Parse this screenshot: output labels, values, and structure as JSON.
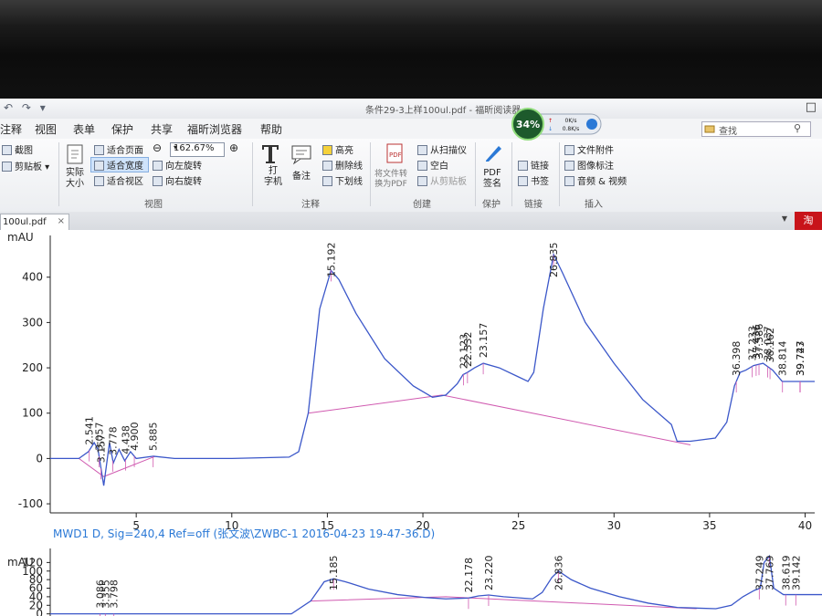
{
  "app": {
    "title": "条件29-3上样100ul.pdf - 福昕阅读器",
    "quick_access": "↶ ↷ ▾"
  },
  "menu": [
    "注释",
    "视图",
    "表单",
    "保护",
    "共享",
    "福昕浏览器",
    "帮助"
  ],
  "search": {
    "placeholder": "查找"
  },
  "ribbon": {
    "screenshot": "截图",
    "clipboard": "剪贴板",
    "actual_size": [
      "实际",
      "大小"
    ],
    "fit_page": "适合页面",
    "fit_width": "适合宽度",
    "fit_view": "适合视区",
    "zoom": "162.67%",
    "rotate_left": "向左旋转",
    "rotate_right": "向右旋转",
    "group_view": "视图",
    "typewriter": [
      "打",
      "字机"
    ],
    "note": "备注",
    "highlight": "高亮",
    "strikeout": "删除线",
    "underline": "下划线",
    "group_comment": "注释",
    "convert": [
      "将文件转",
      "换为PDF"
    ],
    "from_scanner": "从扫描仪",
    "blank": "空白",
    "from_clipboard": "从剪贴板",
    "group_create": "创建",
    "pdf_sign": [
      "PDF",
      "签名"
    ],
    "group_protect": "保护",
    "link": "链接",
    "bookmark": "书签",
    "group_links": "链接",
    "attachment": "文件附件",
    "image_annot": "图像标注",
    "av": "音频 & 视频",
    "group_insert": "插入"
  },
  "overlay": {
    "percent": "34%",
    "up": "0K/s",
    "down": "0.8K/s"
  },
  "tab": {
    "name": "100ul.pdf",
    "close": "×",
    "side_badge": "淘"
  },
  "colors": {
    "trace": "#3b57c9",
    "baseline": "#d05ab0",
    "axis": "#222222",
    "accent": "#2b79d6"
  },
  "chart_data": [
    {
      "type": "line",
      "ylabel": "mAU",
      "yticks": [
        -100,
        0,
        100,
        200,
        300,
        400
      ],
      "xticks": [
        5,
        10,
        15,
        20,
        25,
        30,
        35,
        40
      ],
      "xlim": [
        0.5,
        40.5
      ],
      "ylim": [
        -120,
        480
      ],
      "series": [
        {
          "points": [
            [
              0.5,
              0
            ],
            [
              2.0,
              0
            ],
            [
              2.5,
              15
            ],
            [
              2.8,
              35
            ],
            [
              3.0,
              20
            ],
            [
              3.3,
              -60
            ],
            [
              3.6,
              35
            ],
            [
              3.8,
              -10
            ],
            [
              4.1,
              20
            ],
            [
              4.4,
              -5
            ],
            [
              4.7,
              15
            ],
            [
              5.0,
              0
            ],
            [
              5.9,
              5
            ],
            [
              7,
              0
            ],
            [
              10,
              0
            ],
            [
              13,
              3
            ],
            [
              13.5,
              15
            ],
            [
              14.0,
              100
            ],
            [
              14.6,
              330
            ],
            [
              15.19,
              415
            ],
            [
              15.6,
              395
            ],
            [
              16.5,
              320
            ],
            [
              18,
              220
            ],
            [
              19.5,
              160
            ],
            [
              20.5,
              135
            ],
            [
              21.2,
              140
            ],
            [
              21.8,
              165
            ],
            [
              22.1,
              185
            ],
            [
              22.33,
              190
            ],
            [
              22.7,
              200
            ],
            [
              23.16,
              210
            ],
            [
              24,
              200
            ],
            [
              25,
              180
            ],
            [
              25.5,
              170
            ],
            [
              25.8,
              190
            ],
            [
              26.3,
              330
            ],
            [
              26.84,
              450
            ],
            [
              27.3,
              410
            ],
            [
              28.5,
              300
            ],
            [
              30,
              210
            ],
            [
              31.5,
              130
            ],
            [
              33,
              75
            ],
            [
              33.3,
              38
            ],
            [
              34,
              38
            ],
            [
              35.3,
              45
            ],
            [
              35.9,
              80
            ],
            [
              36.3,
              160
            ],
            [
              36.6,
              190
            ],
            [
              36.9,
              195
            ],
            [
              37.3,
              205
            ],
            [
              37.8,
              210
            ],
            [
              38.3,
              195
            ],
            [
              38.8,
              170
            ],
            [
              39.5,
              170
            ],
            [
              40.5,
              170
            ]
          ]
        }
      ],
      "peak_labels": [
        "2.541",
        "3.057",
        "3.157",
        "3.778",
        "4.438",
        "4.900",
        "5.885",
        "15.192",
        "22.123",
        "22.332",
        "23.157",
        "26.835",
        "36.398",
        "37.233",
        "37.436",
        "37.586",
        "38.037",
        "38.162",
        "38.814",
        "39.727",
        "39.743"
      ]
    },
    {
      "type": "line",
      "title": "MWD1 D, Sig=240,4 Ref=off (张文波\\ZWBC-1 2016-04-23 19-47-36.D)",
      "ylabel": "mAU",
      "yticks": [
        0,
        20,
        40,
        60,
        80,
        100,
        120
      ],
      "xlim": [
        0.5,
        40.5
      ],
      "ylim": [
        -5,
        140
      ],
      "series": [
        {
          "points": [
            [
              0.5,
              0
            ],
            [
              13,
              0
            ],
            [
              14.0,
              30
            ],
            [
              14.7,
              75
            ],
            [
              15.18,
              82
            ],
            [
              15.8,
              75
            ],
            [
              17,
              58
            ],
            [
              18.5,
              45
            ],
            [
              20,
              38
            ],
            [
              21,
              35
            ],
            [
              22.18,
              37
            ],
            [
              22.7,
              42
            ],
            [
              23.22,
              44
            ],
            [
              24,
              40
            ],
            [
              25.5,
              35
            ],
            [
              26,
              50
            ],
            [
              26.5,
              85
            ],
            [
              26.84,
              100
            ],
            [
              27.5,
              80
            ],
            [
              28.5,
              60
            ],
            [
              30,
              40
            ],
            [
              31.5,
              25
            ],
            [
              33,
              15
            ],
            [
              35,
              12
            ],
            [
              35.8,
              20
            ],
            [
              36.4,
              40
            ],
            [
              37.0,
              55
            ],
            [
              37.3,
              60
            ],
            [
              37.5,
              120
            ],
            [
              37.77,
              135
            ],
            [
              38.0,
              60
            ],
            [
              38.5,
              45
            ],
            [
              39.2,
              45
            ],
            [
              40.5,
              45
            ]
          ]
        }
      ],
      "peak_labels": [
        "3.086",
        "3.355",
        "3.798",
        "15.185",
        "22.178",
        "23.220",
        "26.836",
        "37.249",
        "37.769",
        "38.619",
        "39.142"
      ]
    }
  ]
}
